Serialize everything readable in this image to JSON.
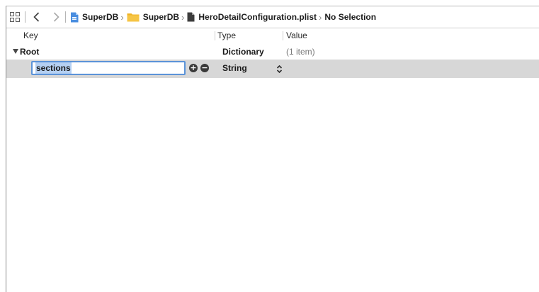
{
  "jumpbar": {
    "crumbs": [
      {
        "label": "SuperDB",
        "icon": "project-icon"
      },
      {
        "label": "SuperDB",
        "icon": "folder-icon"
      },
      {
        "label": "HeroDetailConfiguration.plist",
        "icon": "plist-file-icon"
      },
      {
        "label": "No Selection",
        "icon": ""
      }
    ],
    "icons": {
      "related": "related-items-grid-icon",
      "back": "back-chevron-icon",
      "forward": "forward-chevron-icon"
    },
    "colors": {
      "project_icon": "#4a8ee0",
      "folder_icon": "#f0b323"
    }
  },
  "columns": {
    "key": "Key",
    "type": "Type",
    "value": "Value"
  },
  "rows": [
    {
      "key": "Root",
      "type": "Dictionary",
      "value": "(1 item)",
      "expanded": true
    },
    {
      "key": "sections",
      "type": "String",
      "value": "",
      "editing": true,
      "selected": true
    }
  ],
  "colors": {
    "selected_row": "#d7d7d7",
    "edit_border": "#5b93d8",
    "text_selection": "#b5d0f2"
  }
}
